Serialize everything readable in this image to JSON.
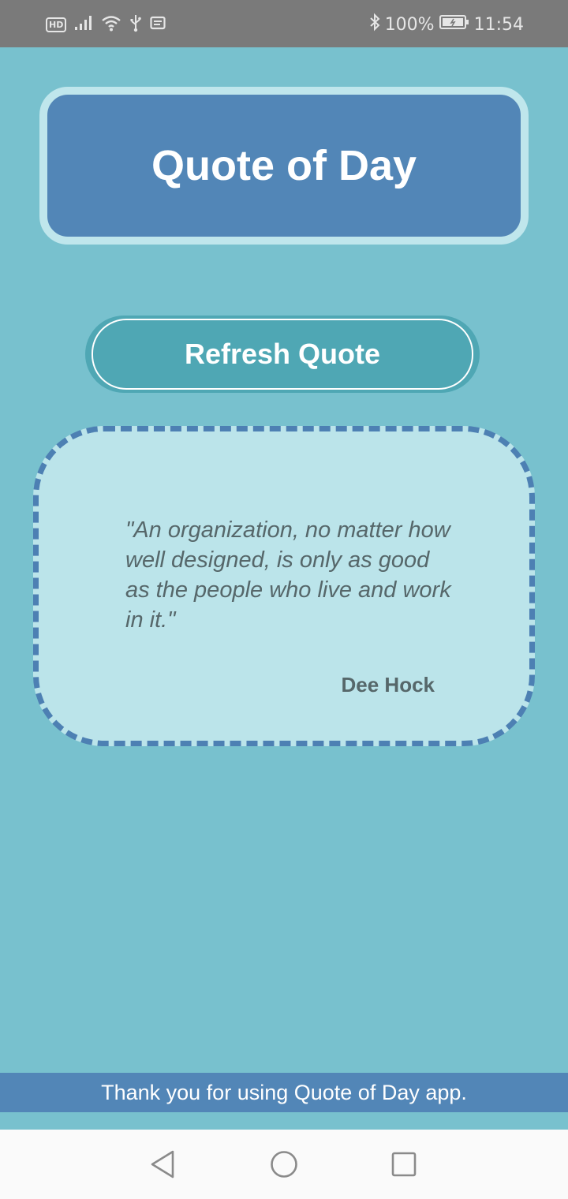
{
  "status_bar": {
    "battery_percent": "100%",
    "time": "11:54",
    "network_badge": "HD",
    "icons": [
      "hd-icon",
      "signal-icon",
      "wifi-icon",
      "usb-icon",
      "notification-icon",
      "bluetooth-icon",
      "battery-icon"
    ]
  },
  "header": {
    "title": "Quote of Day"
  },
  "refresh_button": {
    "label": "Refresh Quote"
  },
  "quote": {
    "text": "\"An organization, no matter how well designed, is only as good as the people who live and work in it.\"",
    "author": "Dee Hock"
  },
  "footer": {
    "text": "Thank you for using Quote of Day app."
  },
  "colors": {
    "background": "#78c1ce",
    "title_card": "#5286b7",
    "button": "#4fa7b4",
    "quote_card": "#bbe4ea",
    "footer": "#5286b7"
  },
  "nav_bar": {
    "buttons": [
      "back-icon",
      "home-icon",
      "recents-icon"
    ]
  }
}
